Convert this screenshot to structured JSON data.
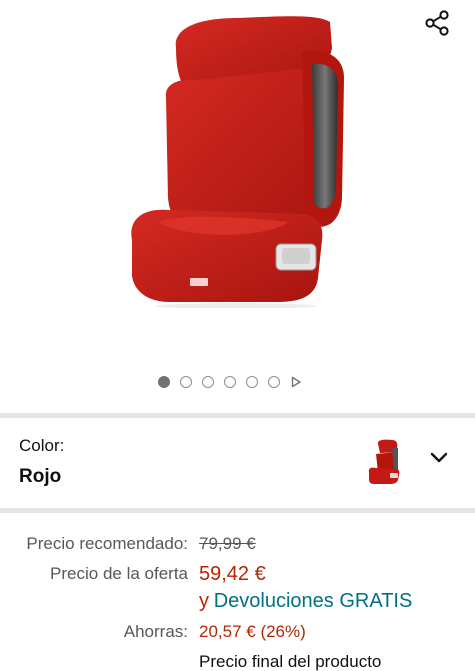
{
  "gallery": {
    "image_alt": "Silla de coche infantil roja",
    "dots_total": 6,
    "dots_active_index": 0,
    "share_icon": "share-icon",
    "next_icon": "play-triangle-icon"
  },
  "variation": {
    "label": "Color:",
    "value": "Rojo",
    "expand_icon": "chevron-down-icon"
  },
  "pricing": {
    "list_label": "Precio recomendado:",
    "list_price": "79,99 €",
    "offer_label": "Precio de la oferta",
    "offer_price": "59,42 €",
    "returns_prefix": "y",
    "returns_text": "Devoluciones GRATIS",
    "savings_label": "Ahorras:",
    "savings_value": "20,57 € (26%)",
    "final_text": "Precio final del producto"
  },
  "colors": {
    "price_red": "#b12704",
    "link_teal": "#007185",
    "product_red": "#c41a16"
  }
}
